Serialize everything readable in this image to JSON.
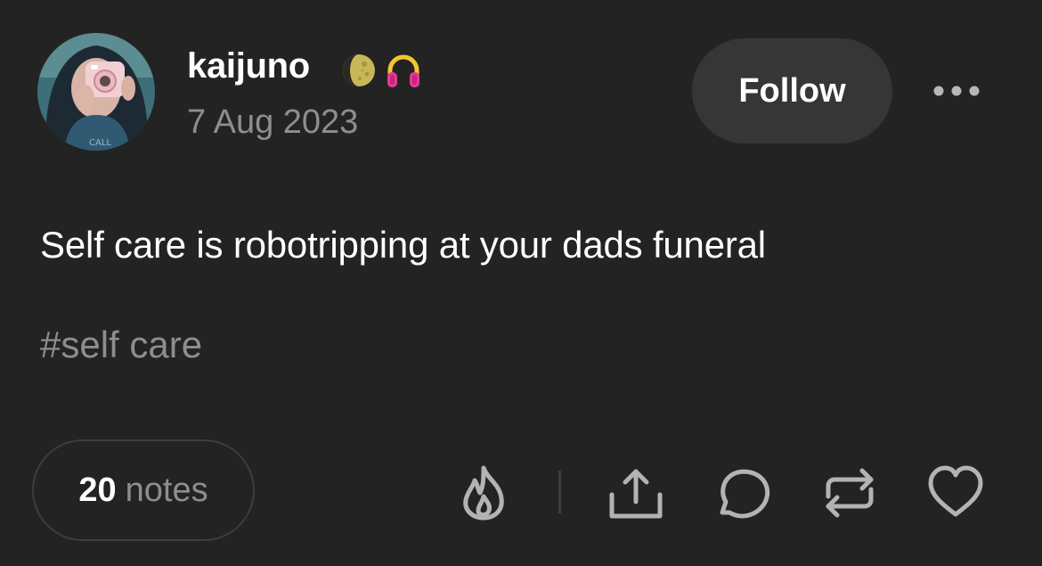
{
  "post": {
    "author": {
      "username": "kaijuno",
      "badges": [
        "moon-icon",
        "headphones-icon"
      ]
    },
    "date": "7 Aug 2023",
    "follow_label": "Follow",
    "body": "Self care is robotripping at your dads funeral",
    "tag": "#self care",
    "notes": {
      "count": "20",
      "label": "notes"
    },
    "actions": [
      "flame-icon",
      "share-icon",
      "reply-icon",
      "reblog-icon",
      "like-icon"
    ]
  },
  "colors": {
    "background": "#232323",
    "text_primary": "#ffffff",
    "text_secondary": "#8e8e8e",
    "button_bg": "#363636",
    "icon": "#b0b0b0"
  }
}
